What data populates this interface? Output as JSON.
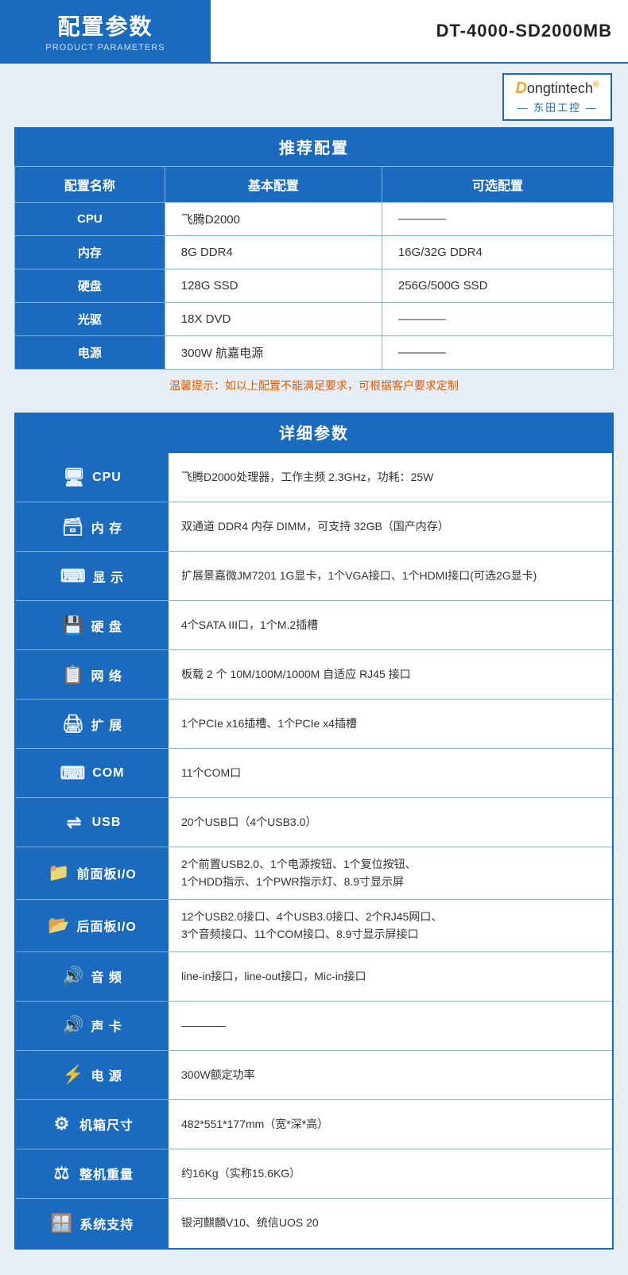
{
  "header": {
    "title_cn": "配置参数",
    "title_en": "PRODUCT PARAMETERS",
    "model": "DT-4000-SD2000MB"
  },
  "logo": {
    "brand": "Dongtintech",
    "sub": "— 东田工控 —",
    "registered": "®"
  },
  "recommended": {
    "section_title": "推荐配置",
    "columns": [
      "配置名称",
      "基本配置",
      "可选配置"
    ],
    "rows": [
      {
        "name": "CPU",
        "basic": "飞腾D2000",
        "optional": "————"
      },
      {
        "name": "内存",
        "basic": "8G DDR4",
        "optional": "16G/32G DDR4"
      },
      {
        "name": "硬盘",
        "basic": "128G SSD",
        "optional": "256G/500G SSD"
      },
      {
        "name": "光驱",
        "basic": "18X DVD",
        "optional": "————"
      },
      {
        "name": "电源",
        "basic": "300W 航嘉电源",
        "optional": "————"
      }
    ],
    "warm_tip": "温馨提示：如以上配置不能满足要求，可根据客户要求定制"
  },
  "detail": {
    "section_title": "详细参数",
    "rows": [
      {
        "label": "CPU",
        "icon": "🖥",
        "value": "飞腾D2000处理器，工作主频 2.3GHz，功耗：25W"
      },
      {
        "label": "内 存",
        "icon": "🗃",
        "value": "双通道 DDR4 内存 DIMM，可支持 32GB（国产内存）"
      },
      {
        "label": "显 示",
        "icon": "⌨",
        "value": "扩展景嘉微JM7201 1G显卡，1个VGA接口、1个HDMI接口(可选2G显卡)"
      },
      {
        "label": "硬 盘",
        "icon": "💾",
        "value": "4个SATA III口，1个M.2插槽"
      },
      {
        "label": "网 络",
        "icon": "📋",
        "value": "板载 2 个 10M/100M/1000M 自适应 RJ45 接口"
      },
      {
        "label": "扩 展",
        "icon": "🖨",
        "value": "1个PCIe x16插槽、1个PCIe x4插槽"
      },
      {
        "label": "COM",
        "icon": "⌨",
        "value": "11个COM口"
      },
      {
        "label": "USB",
        "icon": "⇌",
        "value": "20个USB口（4个USB3.0）"
      },
      {
        "label": "前面板I/O",
        "icon": "📁",
        "value": "2个前置USB2.0、1个电源按钮、1个复位按钮、\n1个HDD指示、1个PWR指示灯、8.9寸显示屏"
      },
      {
        "label": "后面板I/O",
        "icon": "📂",
        "value": "12个USB2.0接口、4个USB3.0接口、2个RJ45网口、\n3个音频接口、11个COM接口、8.9寸显示屏接口"
      },
      {
        "label": "音 频",
        "icon": "🔊",
        "value": "line-in接口，line-out接口，Mic-in接口"
      },
      {
        "label": "声 卡",
        "icon": "🔊",
        "value": "————"
      },
      {
        "label": "电 源",
        "icon": "⚡",
        "value": "300W额定功率"
      },
      {
        "label": "机箱尺寸",
        "icon": "⚙",
        "value": "482*551*177mm（宽*深*高）"
      },
      {
        "label": "整机重量",
        "icon": "⚖",
        "value": "约16Kg（实称15.6KG）"
      },
      {
        "label": "系统支持",
        "icon": "🪟",
        "value": "银河麒麟V10、统信UOS 20"
      }
    ]
  }
}
